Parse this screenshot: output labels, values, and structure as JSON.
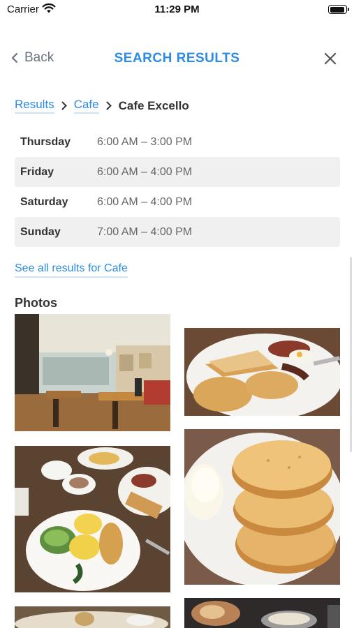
{
  "status_bar": {
    "carrier": "Carrier",
    "time": "11:29 PM"
  },
  "nav": {
    "back_label": "Back",
    "title": "SEARCH RESULTS"
  },
  "breadcrumb": {
    "items": [
      "Results",
      "Cafe"
    ],
    "current": "Cafe Excello"
  },
  "hours": [
    {
      "day": "Thursday",
      "time": "6:00 AM – 3:00 PM"
    },
    {
      "day": "Friday",
      "time": "6:00 AM – 4:00 PM"
    },
    {
      "day": "Saturday",
      "time": "6:00 AM – 4:00 PM"
    },
    {
      "day": "Sunday",
      "time": "7:00 AM – 4:00 PM"
    }
  ],
  "see_all_label": "See all results for Cafe",
  "photos_heading": "Photos",
  "colors": {
    "accent": "#2b8be6",
    "row_alt": "#f0f0f0"
  }
}
